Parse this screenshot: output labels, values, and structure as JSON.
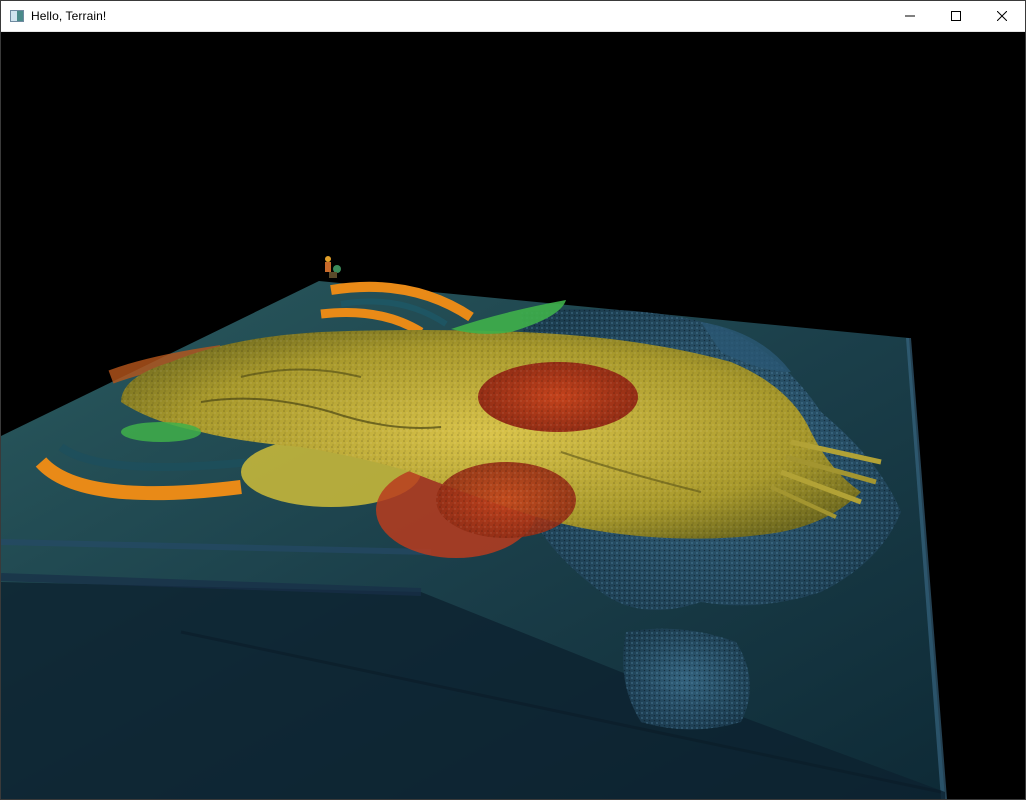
{
  "window": {
    "title": "Hello, Terrain!",
    "icon": "app-window-icon",
    "controls": {
      "minimize_icon": "minimize-icon",
      "maximize_icon": "maximize-icon",
      "close_icon": "close-icon"
    }
  },
  "scene": {
    "background_color": "#000000",
    "palette": {
      "ground_teal": "#1f4d55",
      "terrain_yellow": "#b9a730",
      "terrain_red": "#b53a1c",
      "ring_orange": "#e98a17",
      "grass_green": "#3fb04a",
      "edge_blue": "#3c6d8a"
    }
  }
}
